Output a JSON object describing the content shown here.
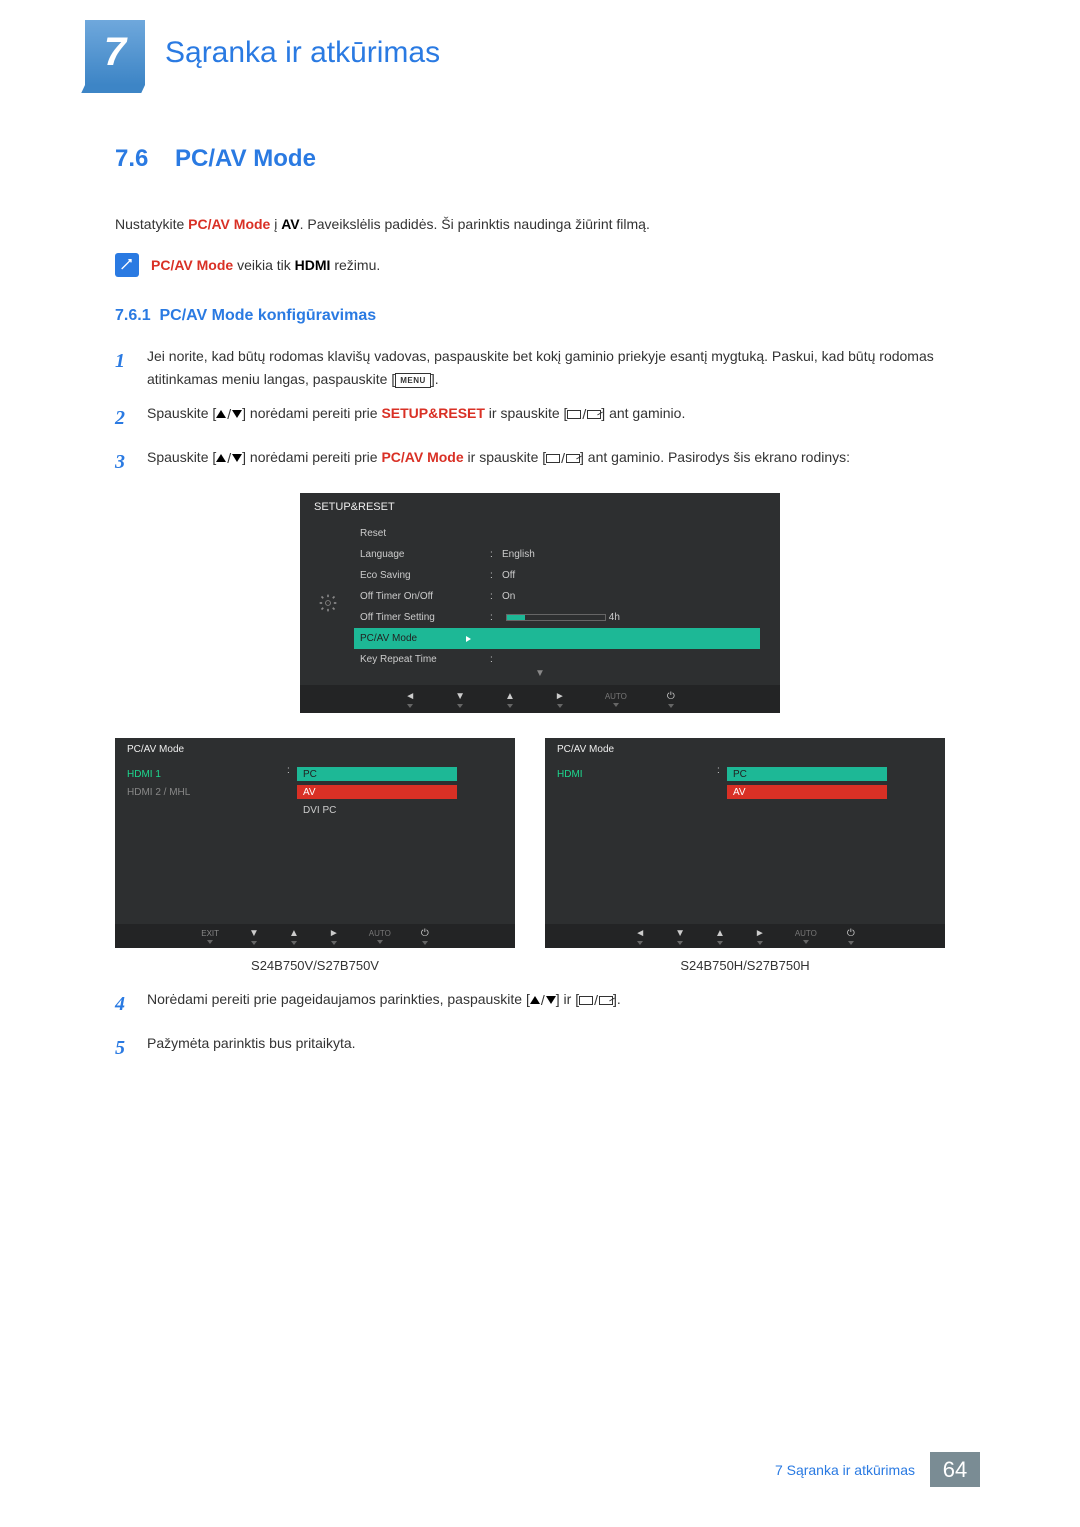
{
  "chapter": {
    "num": "7",
    "title": "Sąranka ir atkūrimas"
  },
  "section": {
    "num": "7.6",
    "title": "PC/AV Mode"
  },
  "intro": {
    "prefix": "Nustatykite ",
    "term1": "PC/AV Mode",
    "mid": " į ",
    "term2": "AV",
    "suffix": ". Paveikslėlis padidės. Ši parinktis naudinga žiūrint filmą."
  },
  "note": {
    "term1": "PC/AV Mode",
    "mid": " veikia tik ",
    "term2": "HDMI",
    "suffix": " režimu."
  },
  "subsection": {
    "num": "7.6.1",
    "title": "PC/AV Mode konfigūravimas"
  },
  "steps": {
    "s1a": "Jei norite, kad būtų rodomas klavišų vadovas, paspauskite bet kokį gaminio priekyje esantį mygtuką. Paskui, kad būtų rodomas atitinkamas meniu langas, paspauskite [",
    "s1btn": "MENU",
    "s1b": "].",
    "s2a": "Spauskite [",
    "s2b": "] norėdami pereiti prie ",
    "s2term": "SETUP&RESET",
    "s2c": " ir spauskite [",
    "s2d": "] ant gaminio.",
    "s3a": "Spauskite [",
    "s3b": "] norėdami pereiti prie ",
    "s3term": "PC/AV Mode",
    "s3c": " ir spauskite [",
    "s3d": "] ant gaminio. Pasirodys šis ekrano rodinys:",
    "s4a": "Norėdami pereiti prie pageidaujamos parinkties, paspauskite [",
    "s4b": "] ir [",
    "s4c": "].",
    "s5": "Pažymėta parinktis bus pritaikyta."
  },
  "osd_main": {
    "title": "SETUP&RESET",
    "rows": {
      "reset": "Reset",
      "language": "Language",
      "language_val": "English",
      "eco": "Eco Saving",
      "eco_val": "Off",
      "timer_on": "Off Timer On/Off",
      "timer_on_val": "On",
      "timer_set": "Off Timer Setting",
      "timer_set_val": "4h",
      "pcav": "PC/AV Mode",
      "keyrep": "Key Repeat Time"
    },
    "nav": {
      "auto": "AUTO"
    }
  },
  "osd_left": {
    "title": "PC/AV Mode",
    "hdmi1": "HDMI 1",
    "hdmi2": "HDMI 2 / MHL",
    "pc": "PC",
    "av": "AV",
    "dvi": "DVI PC",
    "exit": "EXIT",
    "auto": "AUTO",
    "model": "S24B750V/S27B750V"
  },
  "osd_right": {
    "title": "PC/AV Mode",
    "hdmi": "HDMI",
    "pc": "PC",
    "av": "AV",
    "auto": "AUTO",
    "model": "S24B750H/S27B750H"
  },
  "footer": {
    "text": "7 Sąranka ir atkūrimas",
    "page": "64"
  }
}
